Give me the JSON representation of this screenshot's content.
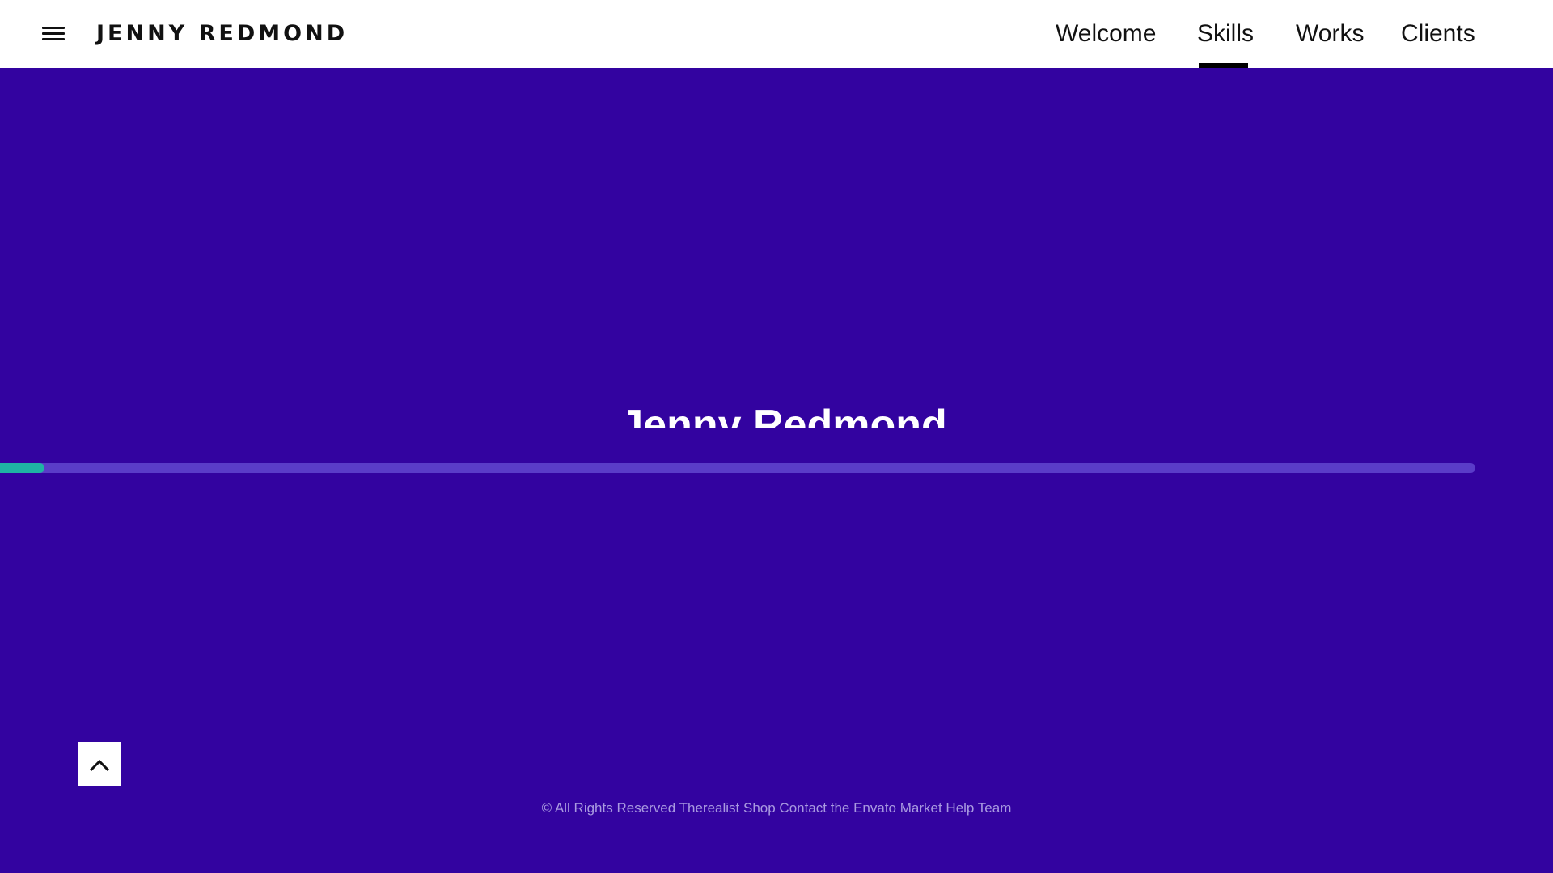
{
  "header": {
    "brand": "JENNY REDMOND",
    "menu_icon": "hamburger-menu-icon",
    "nav": {
      "welcome": "Welcome",
      "skills": "Skills",
      "works": "Works",
      "clients": "Clients"
    },
    "active_nav": "Skills"
  },
  "hero": {
    "title": "Jenny Redmond",
    "progress_fraction": 0.03,
    "background_color": "#3303a0",
    "progress_color": "#1fb3a4"
  },
  "back_to_top": {
    "icon": "chevron-up-icon"
  },
  "footer": {
    "text": "© All Rights Reserved Therealist Shop Contact the Envato Market Help Team"
  }
}
